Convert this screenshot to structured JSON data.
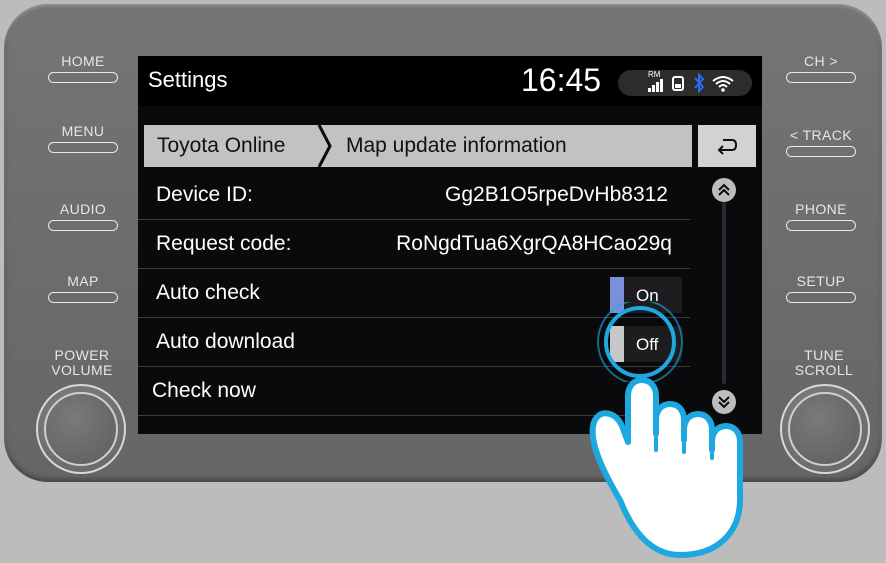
{
  "bezel_buttons": {
    "left": [
      "HOME",
      "MENU",
      "AUDIO",
      "MAP"
    ],
    "right": [
      "CH >",
      "< TRACK",
      "PHONE",
      "SETUP"
    ],
    "power_volume": [
      "POWER",
      "VOLUME"
    ],
    "tune_scroll": [
      "TUNE",
      "SCROLL"
    ]
  },
  "header": {
    "title": "Settings",
    "clock": "16:45",
    "rm_label": "RM"
  },
  "breadcrumb": {
    "item1": "Toyota Online",
    "item2": "Map update information"
  },
  "rows": {
    "device_id_label": "Device ID:",
    "device_id_value": "Gg2B1O5rpeDvHb8312",
    "request_code_label": "Request code:",
    "request_code_value": "RoNgdTua6XgrQA8HCao29q",
    "auto_check_label": "Auto check",
    "auto_check_state": "On",
    "auto_download_label": "Auto download",
    "auto_download_state": "Off",
    "check_now_label": "Check now"
  },
  "icons": {
    "back": "return-arrow-icon",
    "scroll_up": "chevron-double-up-icon",
    "scroll_down": "chevron-double-down-icon",
    "signal": "signal-bars-icon",
    "phone": "phone-battery-icon",
    "bluetooth": "bluetooth-icon",
    "wifi": "wifi-icon",
    "hand": "tap-hand-icon"
  },
  "colors": {
    "toggle_on_indicator": "#7a90d8",
    "toggle_off_indicator": "#c8c8c8",
    "highlight_ring": "#1ea8e0",
    "bluetooth": "#2a6ef0",
    "breadcrumb_bg": "#c2c2c2"
  }
}
